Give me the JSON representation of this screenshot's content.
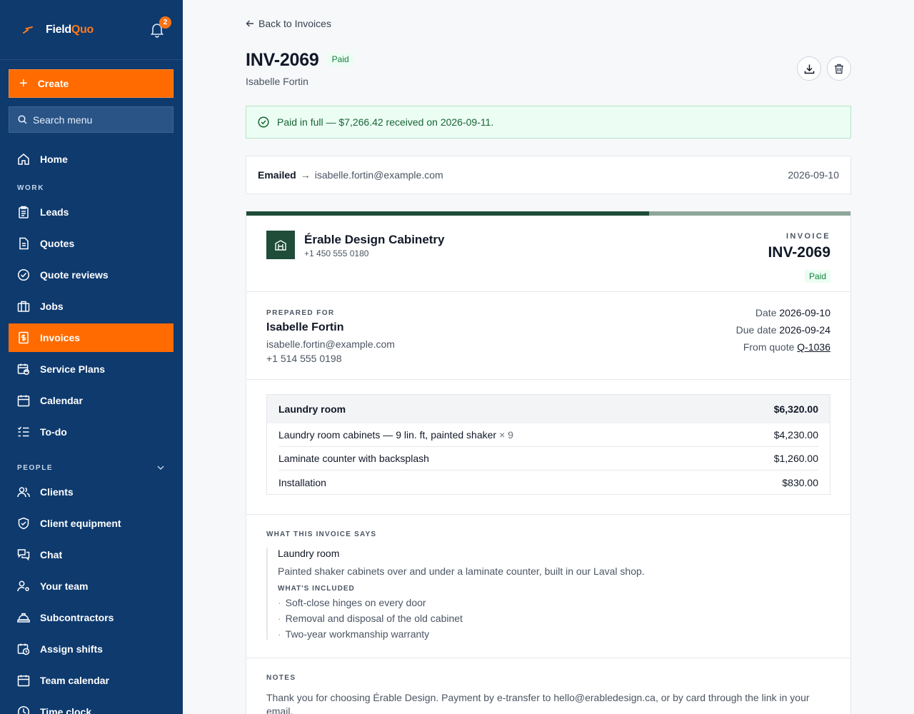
{
  "brand": {
    "name_part1": "Field",
    "name_part2": "Quo",
    "notification_count": "2"
  },
  "sidebar": {
    "create_label": "Create",
    "search_placeholder": "Search menu",
    "home": "Home",
    "section_work": "WORK",
    "work_items": [
      "Leads",
      "Quotes",
      "Quote reviews",
      "Jobs",
      "Invoices",
      "Service Plans",
      "Calendar",
      "To-do"
    ],
    "section_people": "PEOPLE",
    "people_items": [
      "Clients",
      "Client equipment",
      "Chat",
      "Your team",
      "Subcontractors",
      "Assign shifts",
      "Team calendar",
      "Time clock"
    ],
    "active_item": "Invoices"
  },
  "header": {
    "back_label": "Back to Invoices",
    "invoice_number": "INV-2069",
    "status": "Paid",
    "client_name": "Isabelle Fortin"
  },
  "alert": {
    "text": "Paid in full — $7,266.42 received on 2026-09-11."
  },
  "email_event": {
    "label": "Emailed",
    "arrow": "→",
    "address": "isabelle.fortin@example.com",
    "date": "2026-09-10"
  },
  "invoice": {
    "progress_fraction": 0.667,
    "company_name": "Érable Design Cabinetry",
    "company_phone": "+1 450 555 0180",
    "doc_label": "INVOICE",
    "number": "INV-2069",
    "status": "Paid",
    "prepared_label": "PREPARED FOR",
    "client_name": "Isabelle Fortin",
    "client_email": "isabelle.fortin@example.com",
    "client_phone": "+1 514 555 0198",
    "date_label": "Date",
    "date": "2026-09-10",
    "due_label": "Due date",
    "due_date": "2026-09-24",
    "quote_label": "From quote",
    "quote_ref": "Q-1036",
    "group": {
      "name": "Laundry room",
      "total": "$6,320.00"
    },
    "lines": [
      {
        "desc": "Laundry room cabinets — 9 lin. ft, painted shaker",
        "qty": "× 9",
        "amount": "$4,230.00"
      },
      {
        "desc": "Laminate counter with backsplash",
        "qty": "",
        "amount": "$1,260.00"
      },
      {
        "desc": "Installation",
        "qty": "",
        "amount": "$830.00"
      }
    ],
    "says_label": "WHAT THIS INVOICE SAYS",
    "says_title": "Laundry room",
    "says_desc": "Painted shaker cabinets over and under a laminate counter, built in our Laval shop.",
    "included_label": "WHAT'S INCLUDED",
    "included": [
      "Soft-close hinges on every door",
      "Removal and disposal of the old cabinet",
      "Two-year workmanship warranty"
    ],
    "notes_label": "NOTES",
    "notes_text": "Thank you for choosing Érable Design. Payment by e-transfer to hello@erabledesign.ca, or by card through the link in your email."
  },
  "colors": {
    "sidebar": "#0e3a6e",
    "accent": "#ff6b00",
    "brand_green": "#1f4d3a",
    "paid_green": "#15803d"
  }
}
